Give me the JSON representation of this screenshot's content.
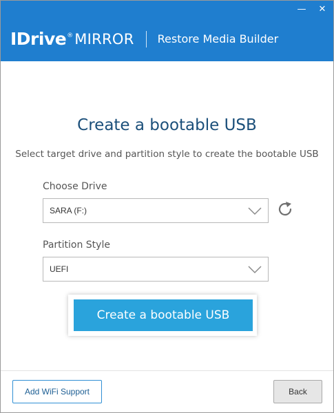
{
  "window": {
    "minimize_glyph": "—",
    "close_glyph": "✕"
  },
  "header": {
    "brand_name": "IDrive",
    "brand_mark": "®",
    "brand_product_line": "MIRROR",
    "product_name": "Restore Media Builder",
    "accent_color": "#1f7ecf"
  },
  "main": {
    "title": "Create a bootable USB",
    "subtitle": "Select target drive and partition style to create the bootable USB",
    "drive": {
      "label": "Choose Drive",
      "value": "SARA (F:)",
      "chevron_icon": "chevron-down-icon",
      "refresh_icon": "refresh-icon"
    },
    "partition": {
      "label": "Partition Style",
      "value": "UEFI",
      "chevron_icon": "chevron-down-icon"
    },
    "create_button_label": "Create a bootable USB",
    "create_button_color": "#2aa3dc"
  },
  "footer": {
    "wifi_button_label": "Add WiFi Support",
    "back_button_label": "Back"
  }
}
